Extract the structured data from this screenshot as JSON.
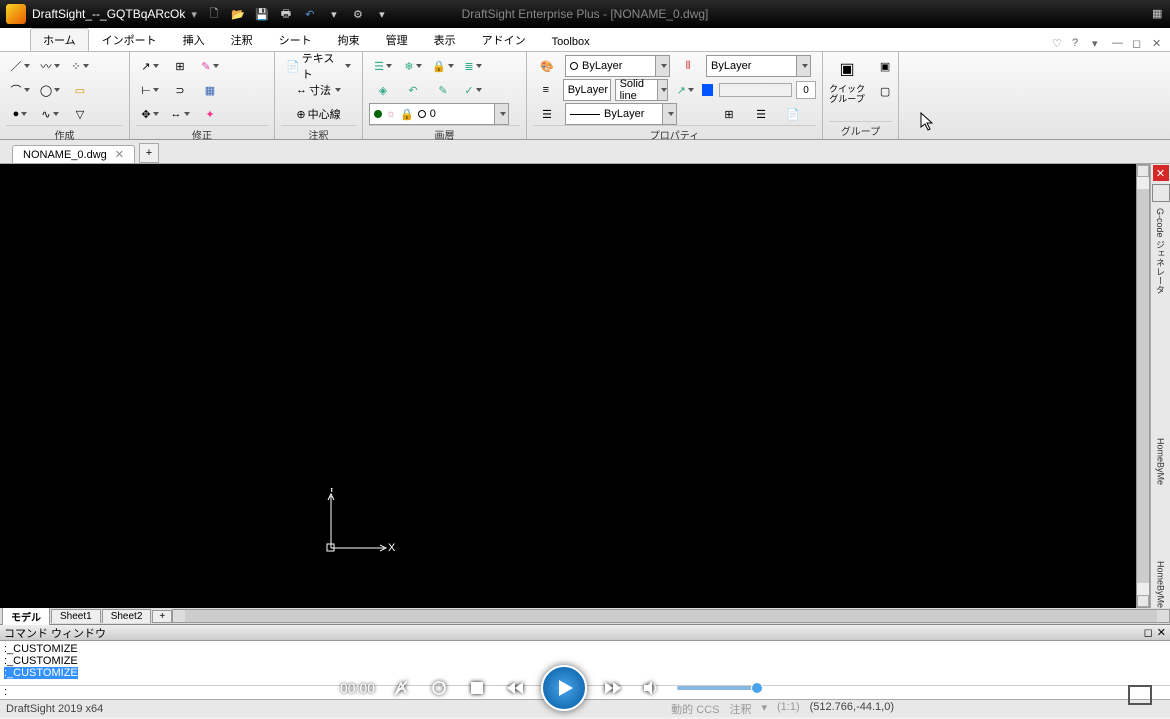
{
  "title_bar": {
    "app_name": "DraftSight_--_GQTBqARcOk",
    "window_title": "DraftSight Enterprise Plus - [NONAME_0.dwg]"
  },
  "menu_tabs": [
    "ホーム",
    "インポート",
    "挿入",
    "注釈",
    "シート",
    "拘束",
    "管理",
    "表示",
    "アドイン",
    "Toolbox"
  ],
  "active_menu_tab": 0,
  "ribbon": {
    "panels": {
      "p1": "作成",
      "p2": "修正",
      "p3": {
        "label": "注釈",
        "text_btn": "テキスト",
        "dim_btn": "寸法",
        "center_btn": "中心線"
      },
      "p4": {
        "label": "画層",
        "layer_display": "0",
        "layer_states": [
          "●",
          "☼",
          "🔒",
          "〇"
        ]
      },
      "p5": {
        "label": "プロパティ",
        "color": "ByLayer",
        "linetype": "ByLayer",
        "linestyle": "Solid line",
        "lineweight": "ByLayer",
        "linetype2": "ByLayer",
        "transparency": "0"
      },
      "p6": {
        "label": "グループ",
        "quick_group": "クイック\nグループ"
      }
    }
  },
  "file_tab": {
    "name": "NONAME_0.dwg"
  },
  "sheet_tabs": [
    "モデル",
    "Sheet1",
    "Sheet2"
  ],
  "active_sheet": 0,
  "command_window": {
    "title": "コマンド ウィンドウ",
    "lines": [
      ":_CUSTOMIZE",
      ":_CUSTOMIZE",
      ":_CUSTOMIZE"
    ],
    "prompt": ":"
  },
  "status": {
    "left": "DraftSight 2019 x64",
    "coords": "(512.766,-44.1,0)",
    "scale": "(1:1)",
    "ccs": "動的 CCS",
    "ann": "注釈"
  },
  "video": {
    "time": "00:00"
  },
  "ucs": {
    "x": "X",
    "y": "Y"
  },
  "side_panels": [
    "G-code ジェネレータ",
    "HomeByMe",
    "HomeByMe"
  ]
}
